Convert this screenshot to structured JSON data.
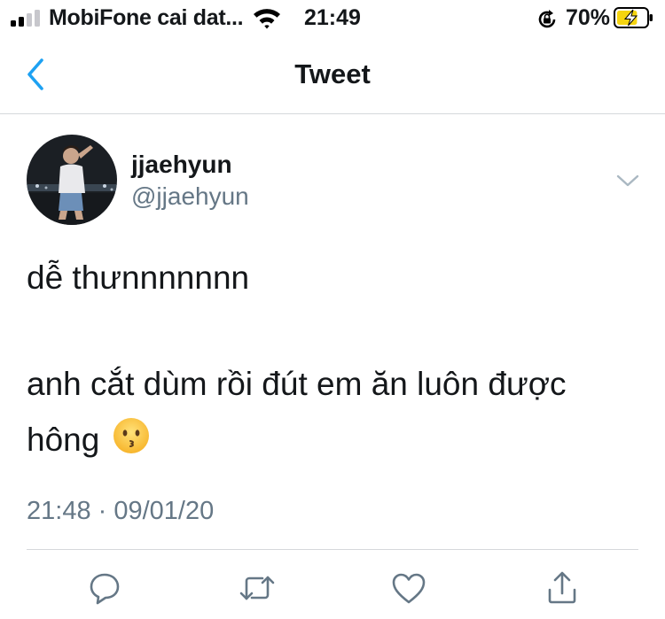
{
  "status_bar": {
    "carrier": "MobiFone cai dat...",
    "time": "21:49",
    "battery_percent": "70%",
    "battery_level": 0.7,
    "signal_bars_filled": 2,
    "icons": [
      "wifi-icon",
      "orientation-lock-icon",
      "battery-charging-icon"
    ]
  },
  "nav": {
    "title": "Tweet",
    "back_icon": "chevron-left-icon"
  },
  "tweet": {
    "author": {
      "display_name": "jjaehyun",
      "handle": "@jjaehyun"
    },
    "text_lines": [
      "dễ thưnnnnnnn",
      "anh cắt dùm rồi đút em ăn luôn được",
      "hông"
    ],
    "emoji": "kissing-face-emoji",
    "timestamp": "21:48 · 09/01/20"
  },
  "actions": {
    "icons": [
      "reply-icon",
      "retweet-icon",
      "like-icon",
      "share-icon"
    ]
  },
  "colors": {
    "accent": "#1da1f2",
    "secondary_text": "#657786",
    "divider": "#d5d8db",
    "battery": "#f5d40f"
  }
}
